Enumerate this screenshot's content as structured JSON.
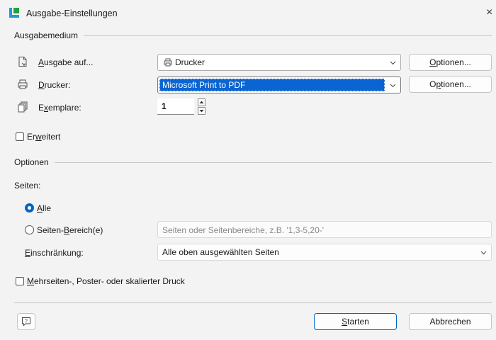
{
  "window": {
    "title": "Ausgabe-Einstellungen",
    "close_symbol": "×",
    "app_icon": "app-logo-icon",
    "accent_color": "#0067c0",
    "selection_color": "#0a64d2"
  },
  "ausgabemedium": {
    "header": "Ausgabemedium",
    "ausgabe_auf": {
      "label_prefix": "",
      "label_mnemonic": "A",
      "label_rest": "usgabe auf...",
      "icon": "page-export-icon",
      "value": "Drucker",
      "value_icon": "printer-icon",
      "options_button": {
        "mnemonic": "O",
        "rest": "ptionen..."
      }
    },
    "drucker": {
      "label_mnemonic": "D",
      "label_rest": "rucker:",
      "icon": "printer-icon",
      "value": "Microsoft Print to PDF",
      "options_button": {
        "prefix": "O",
        "mnemonic": "p",
        "rest": "tionen..."
      }
    },
    "exemplare": {
      "label_prefix": "E",
      "label_mnemonic": "x",
      "label_rest": "emplare:",
      "icon": "copies-icon",
      "value": "1"
    }
  },
  "erweitert": {
    "label_prefix": "Er",
    "label_mnemonic": "w",
    "label_rest": "eitert",
    "checked": false
  },
  "optionen": {
    "header": "Optionen",
    "seiten_label": "Seiten:",
    "alle": {
      "mnemonic": "A",
      "rest": "lle",
      "selected": true
    },
    "bereich": {
      "prefix": "Seiten-",
      "mnemonic": "B",
      "rest": "ereich(e)",
      "selected": false,
      "placeholder": "Seiten oder Seitenbereiche, z.B. '1,3-5,20-'"
    },
    "einschraenkung": {
      "label_mnemonic": "E",
      "label_rest": "inschränkung:",
      "value": "Alle oben ausgewählten Seiten"
    },
    "mehrseiten": {
      "label_mnemonic": "M",
      "label_rest": "ehrseiten-, Poster- oder skalierter Druck",
      "checked": false
    }
  },
  "footer": {
    "help_icon": "help-icon",
    "start_button": {
      "mnemonic": "S",
      "rest": "tarten"
    },
    "cancel_button": "Abbrechen"
  }
}
